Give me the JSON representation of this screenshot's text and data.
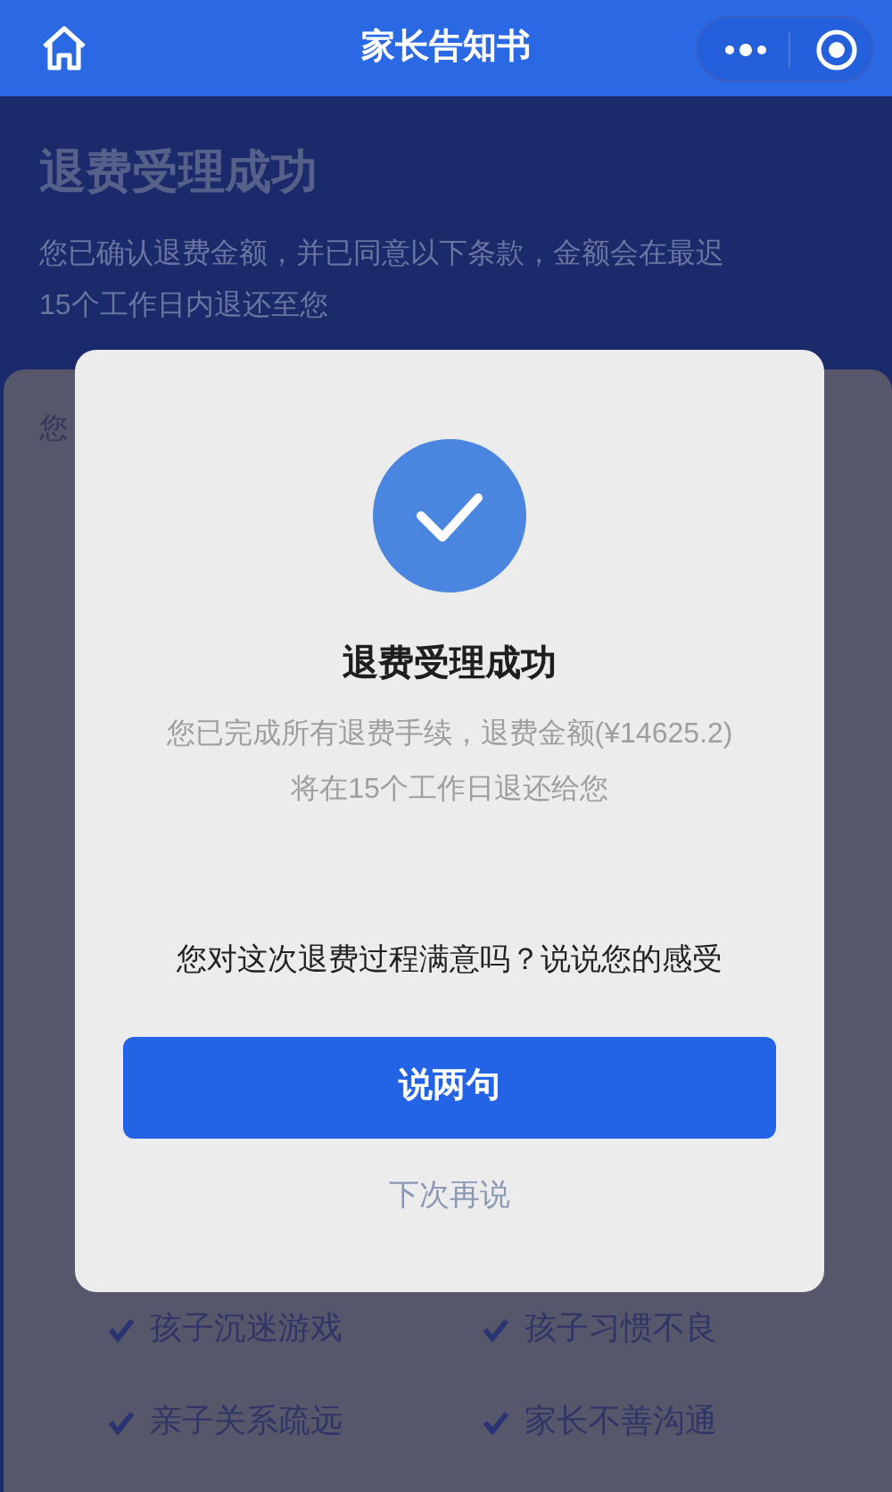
{
  "nav_bar": {
    "title": "家长告知书"
  },
  "page": {
    "title": "退费受理成功",
    "description": [
      "您已确认退费金额，并已同意以下条款，金额会在最迟",
      "15个工作日内退还至您"
    ],
    "card_text": "您",
    "options": [
      {
        "label": "孩子沉迷游戏",
        "checked": true
      },
      {
        "label": "孩子习惯不良",
        "checked": true
      },
      {
        "label": "亲子关系疏远",
        "checked": true
      },
      {
        "label": "家长不善沟通",
        "checked": true
      }
    ]
  },
  "dialog": {
    "title": "退费受理成功",
    "message": [
      "您已完成所有退费手续，退费金额(¥14625.2)",
      "将在15个工作日退还给您"
    ],
    "question": "您对这次退费过程满意吗？说说您的感受",
    "primary_button": "说两句",
    "secondary_link": "下次再说"
  }
}
